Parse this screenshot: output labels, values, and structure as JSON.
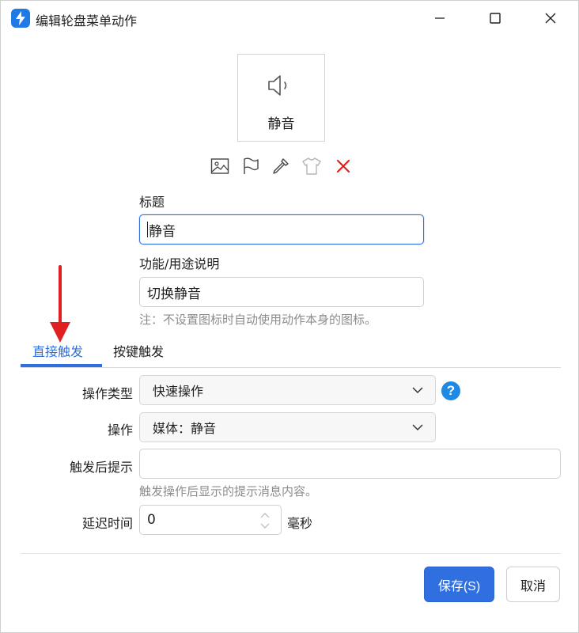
{
  "window": {
    "title": "编辑轮盘菜单动作"
  },
  "preview": {
    "label": "静音",
    "icon": "speaker-mute-icon"
  },
  "icon_tools": [
    {
      "icon": "image-icon"
    },
    {
      "icon": "flag-icon"
    },
    {
      "icon": "eyedropper-icon"
    },
    {
      "icon": "tshirt-icon"
    },
    {
      "icon": "close-x-icon",
      "color": "#e02020"
    }
  ],
  "form": {
    "title_label": "标题",
    "title_value": "静音",
    "desc_label": "功能/用途说明",
    "desc_value": "切换静音",
    "note": "注：不设置图标时自动使用动作本身的图标。"
  },
  "tabs": [
    {
      "label": "直接触发",
      "active": true
    },
    {
      "label": "按键触发",
      "active": false
    }
  ],
  "trigger": {
    "type_label": "操作类型",
    "type_value": "快速操作",
    "action_label": "操作",
    "action_value": "媒体：静音",
    "hint_label": "触发后提示",
    "hint_value": "",
    "hint_note": "触发操作后显示的提示消息内容。",
    "delay_label": "延迟时间",
    "delay_value": "0",
    "delay_unit": "毫秒"
  },
  "buttons": {
    "save": "保存(S)",
    "cancel": "取消"
  },
  "colors": {
    "accent": "#2f6fdc",
    "help": "#1e8ae6",
    "annotation_arrow": "#e02020"
  }
}
